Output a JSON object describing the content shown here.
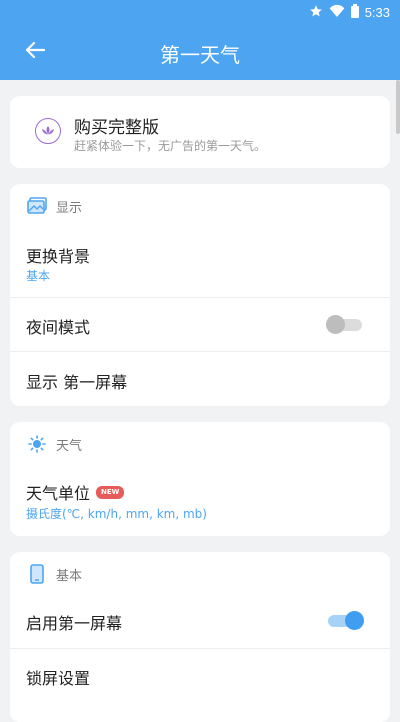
{
  "status": {
    "time": "5:33",
    "icons": [
      "star-icon",
      "wifi-icon",
      "battery-icon"
    ]
  },
  "appbar": {
    "title": "第一天气",
    "back_icon": "back-arrow-icon"
  },
  "buy": {
    "title": "购买完整版",
    "subtitle": "赶紧体验一下，无广告的第一天气。",
    "icon": "lotus-icon"
  },
  "display_section": {
    "header": "显示",
    "icon": "wallpaper-icon",
    "items": [
      {
        "title": "更换背景",
        "subtitle": "基本"
      },
      {
        "title": "夜间模式",
        "toggle": false
      },
      {
        "title": "显示 第一屏幕"
      }
    ]
  },
  "weather_section": {
    "header": "天气",
    "icon": "sun-icon",
    "items": [
      {
        "title": "天气单位",
        "badge": "NEW",
        "subtitle": "摄氏度(℃, km/h, mm, km, mb)"
      }
    ]
  },
  "basic_section": {
    "header": "基本",
    "icon": "phone-icon",
    "items": [
      {
        "title": "启用第一屏幕",
        "toggle": true
      },
      {
        "title": "锁屏设置"
      }
    ]
  },
  "colors": {
    "primary": "#4da5f2",
    "accent_purple": "#9b6bd6",
    "badge_red": "#e85b5b",
    "background": "#f1f2f4"
  }
}
